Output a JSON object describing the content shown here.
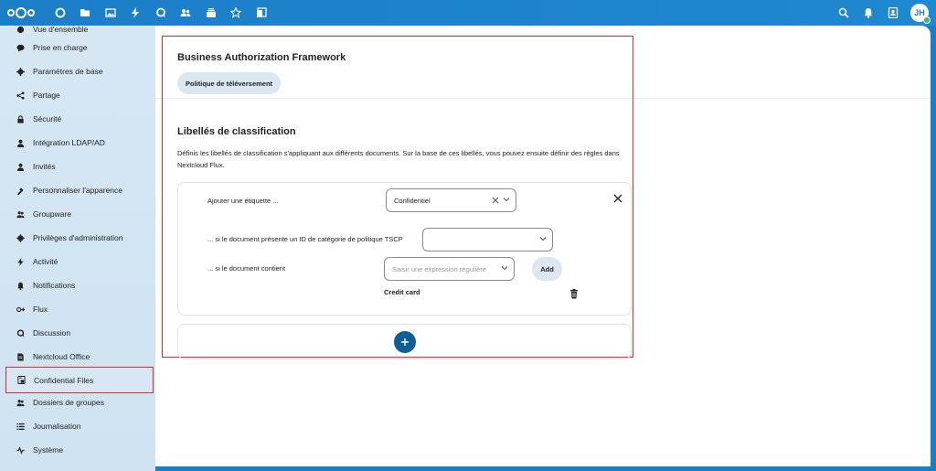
{
  "topbar": {
    "apps": [
      {
        "icon": "dashboard-icon"
      },
      {
        "icon": "files-icon"
      },
      {
        "icon": "photos-icon"
      },
      {
        "icon": "activity-icon"
      },
      {
        "icon": "talk-icon"
      },
      {
        "icon": "contacts-icon"
      },
      {
        "icon": "deck-icon"
      },
      {
        "icon": "favorites-icon"
      },
      {
        "icon": "office-icon"
      }
    ],
    "avatar_initials": "JH"
  },
  "sidebar": {
    "items": [
      {
        "label": "Vue d'ensemble",
        "icon": "overview-icon"
      },
      {
        "label": "Prise en charge",
        "icon": "support-icon"
      },
      {
        "label": "Paramètres de base",
        "icon": "gear-icon"
      },
      {
        "label": "Partage",
        "icon": "share-icon"
      },
      {
        "label": "Sécurité",
        "icon": "lock-icon"
      },
      {
        "label": "Intégration LDAP/AD",
        "icon": "user-icon"
      },
      {
        "label": "Invités",
        "icon": "guest-icon"
      },
      {
        "label": "Personnaliser l'apparence",
        "icon": "theming-icon"
      },
      {
        "label": "Groupware",
        "icon": "groupware-icon"
      },
      {
        "label": "Privilèges d'administration",
        "icon": "admin-icon"
      },
      {
        "label": "Activité",
        "icon": "activity-icon"
      },
      {
        "label": "Notifications",
        "icon": "bell-icon"
      },
      {
        "label": "Flux",
        "icon": "flow-icon"
      },
      {
        "label": "Discussion",
        "icon": "talk-icon"
      },
      {
        "label": "Nextcloud Office",
        "icon": "office-icon"
      },
      {
        "label": "Confidential Files",
        "icon": "confidential-icon"
      },
      {
        "label": "Dossiers de groupes",
        "icon": "group-folder-icon"
      },
      {
        "label": "Journalisation",
        "icon": "log-icon"
      },
      {
        "label": "Système",
        "icon": "system-icon"
      }
    ]
  },
  "main": {
    "baf_title": "Business Authorization Framework",
    "upload_policy_button": "Politique de téléversement",
    "labels_title": "Libellés de classification",
    "labels_description": "Définis les libellés de classification s'appliquant aux différents documents. Sur la base de ces libellés, vous pouvez ensuite définir des règles dans Nextcloud Flux.",
    "rule": {
      "add_label_text": "Ajouter une étiquette ...",
      "label_value": "Confidentiel",
      "tscp_text": "... si le document présente un ID de catégorie de politique TSCP",
      "tscp_value": "",
      "contains_text": "... si le document contient",
      "regex_placeholder": "Saisir une expression régulière",
      "add_button": "Add",
      "expression": "Credit card"
    }
  }
}
